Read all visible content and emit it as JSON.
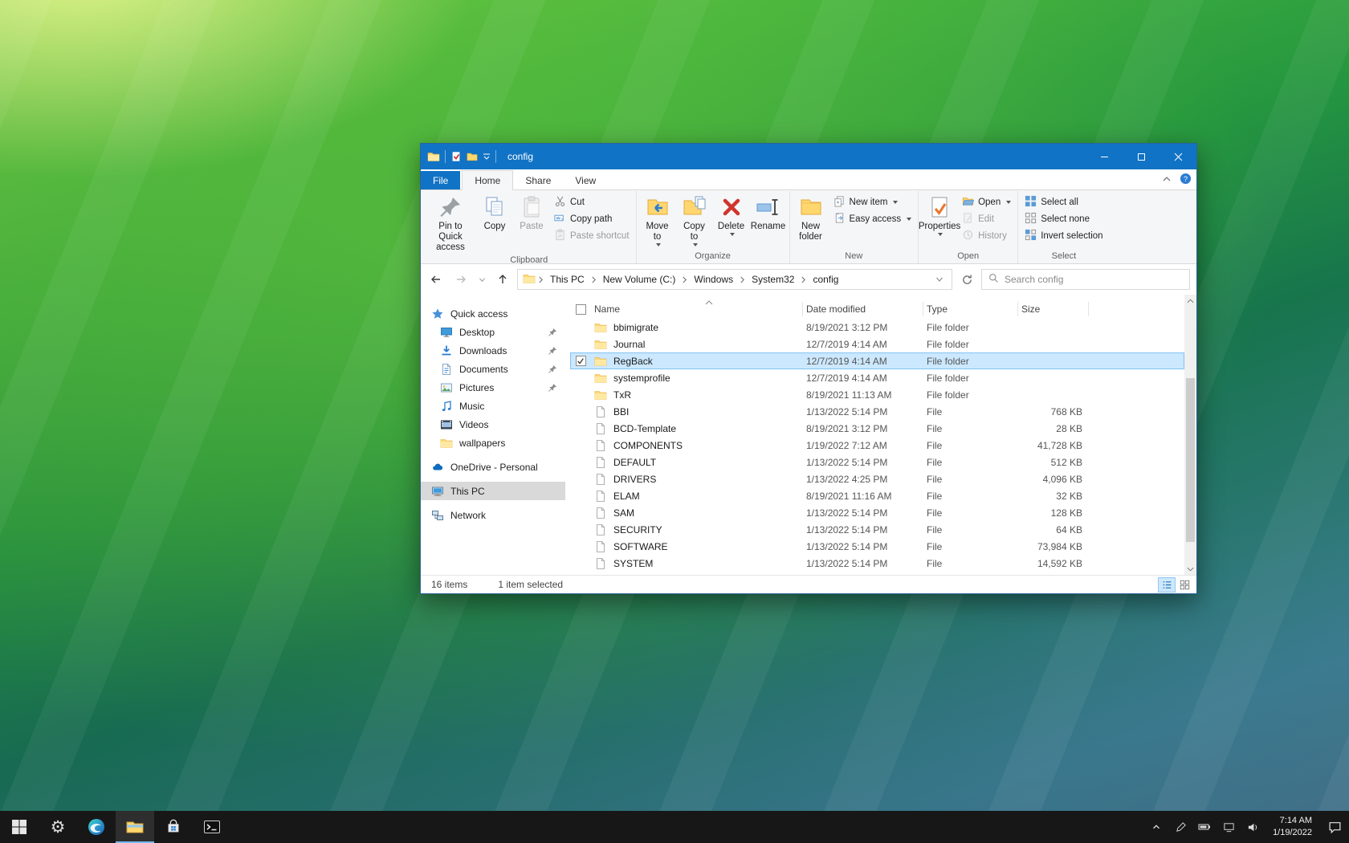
{
  "window": {
    "title": "config",
    "tabs": {
      "file": "File",
      "home": "Home",
      "share": "Share",
      "view": "View"
    }
  },
  "icons": {
    "app": "folder",
    "qat_properties": "check-page",
    "qat_new_folder": "folder",
    "qat_customize": "chevron-down",
    "minimize": "dash",
    "maximize": "square",
    "close": "x",
    "back": "arrow-left",
    "forward": "arrow-right",
    "recent": "chevron-down",
    "up": "arrow-up",
    "refresh": "circular-arrow",
    "search": "magnifier",
    "help": "question-mark",
    "ribbon_collapse": "chevron-up",
    "sort_ascending": "chevron-up"
  },
  "ribbon": {
    "clipboard": {
      "label": "Clipboard",
      "pin": "Pin to Quick access",
      "copy": "Copy",
      "paste": "Paste",
      "cut": "Cut",
      "copy_path": "Copy path",
      "paste_shortcut": "Paste shortcut"
    },
    "organize": {
      "label": "Organize",
      "move_to": "Move to",
      "copy_to": "Copy to",
      "delete": "Delete",
      "rename": "Rename"
    },
    "new_group": {
      "label": "New",
      "new_folder": "New folder",
      "new_item": "New item",
      "easy_access": "Easy access"
    },
    "open_group": {
      "label": "Open",
      "properties": "Properties",
      "open": "Open",
      "edit": "Edit",
      "history": "History"
    },
    "select_group": {
      "label": "Select",
      "select_all": "Select all",
      "select_none": "Select none",
      "invert_selection": "Invert selection"
    }
  },
  "addressbar": {
    "breadcrumb": [
      "This PC",
      "New Volume (C:)",
      "Windows",
      "System32",
      "config"
    ],
    "search_placeholder": "Search config"
  },
  "sidebar": {
    "items": [
      {
        "label": "Quick access",
        "icon": "star-icon",
        "root": true,
        "gap": false
      },
      {
        "label": "Desktop",
        "icon": "desktop-icon",
        "pinned": true
      },
      {
        "label": "Downloads",
        "icon": "downloads-icon",
        "pinned": true
      },
      {
        "label": "Documents",
        "icon": "documents-icon",
        "pinned": true
      },
      {
        "label": "Pictures",
        "icon": "pictures-icon",
        "pinned": true
      },
      {
        "label": "Music",
        "icon": "music-icon"
      },
      {
        "label": "Videos",
        "icon": "videos-icon"
      },
      {
        "label": "wallpapers",
        "icon": "folder-icon"
      },
      {
        "label": "OneDrive - Personal",
        "icon": "onedrive-icon",
        "root": true,
        "gap": true
      },
      {
        "label": "This PC",
        "icon": "thispc-icon",
        "root": true,
        "gap": true,
        "selected": true
      },
      {
        "label": "Network",
        "icon": "network-icon",
        "root": true,
        "gap": true
      }
    ]
  },
  "files": {
    "columns": {
      "name": "Name",
      "date": "Date modified",
      "type": "Type",
      "size": "Size"
    },
    "rows": [
      {
        "name": "bbimigrate",
        "date": "8/19/2021 3:12 PM",
        "type": "File folder",
        "size": "",
        "kind": "folder"
      },
      {
        "name": "Journal",
        "date": "12/7/2019 4:14 AM",
        "type": "File folder",
        "size": "",
        "kind": "folder"
      },
      {
        "name": "RegBack",
        "date": "12/7/2019 4:14 AM",
        "type": "File folder",
        "size": "",
        "kind": "folder",
        "selected": true
      },
      {
        "name": "systemprofile",
        "date": "12/7/2019 4:14 AM",
        "type": "File folder",
        "size": "",
        "kind": "folder"
      },
      {
        "name": "TxR",
        "date": "8/19/2021 11:13 AM",
        "type": "File folder",
        "size": "",
        "kind": "folder"
      },
      {
        "name": "BBI",
        "date": "1/13/2022 5:14 PM",
        "type": "File",
        "size": "768 KB",
        "kind": "file"
      },
      {
        "name": "BCD-Template",
        "date": "8/19/2021 3:12 PM",
        "type": "File",
        "size": "28 KB",
        "kind": "file"
      },
      {
        "name": "COMPONENTS",
        "date": "1/19/2022 7:12 AM",
        "type": "File",
        "size": "41,728 KB",
        "kind": "file"
      },
      {
        "name": "DEFAULT",
        "date": "1/13/2022 5:14 PM",
        "type": "File",
        "size": "512 KB",
        "kind": "file"
      },
      {
        "name": "DRIVERS",
        "date": "1/13/2022 4:25 PM",
        "type": "File",
        "size": "4,096 KB",
        "kind": "file"
      },
      {
        "name": "ELAM",
        "date": "8/19/2021 11:16 AM",
        "type": "File",
        "size": "32 KB",
        "kind": "file"
      },
      {
        "name": "SAM",
        "date": "1/13/2022 5:14 PM",
        "type": "File",
        "size": "128 KB",
        "kind": "file"
      },
      {
        "name": "SECURITY",
        "date": "1/13/2022 5:14 PM",
        "type": "File",
        "size": "64 KB",
        "kind": "file"
      },
      {
        "name": "SOFTWARE",
        "date": "1/13/2022 5:14 PM",
        "type": "File",
        "size": "73,984 KB",
        "kind": "file"
      },
      {
        "name": "SYSTEM",
        "date": "1/13/2022 5:14 PM",
        "type": "File",
        "size": "14,592 KB",
        "kind": "file"
      }
    ]
  },
  "statusbar": {
    "items_count": "16 items",
    "selection": "1 item selected"
  },
  "taskbar": {
    "clock_time": "7:14 AM",
    "clock_date": "1/19/2022"
  },
  "colors": {
    "titlebar": "#1173c5",
    "selection_fill": "#cce8ff",
    "selection_border": "#84c3f1",
    "accent_blue": "#2b7cd3",
    "folder_yellow": "#ffd76e"
  }
}
